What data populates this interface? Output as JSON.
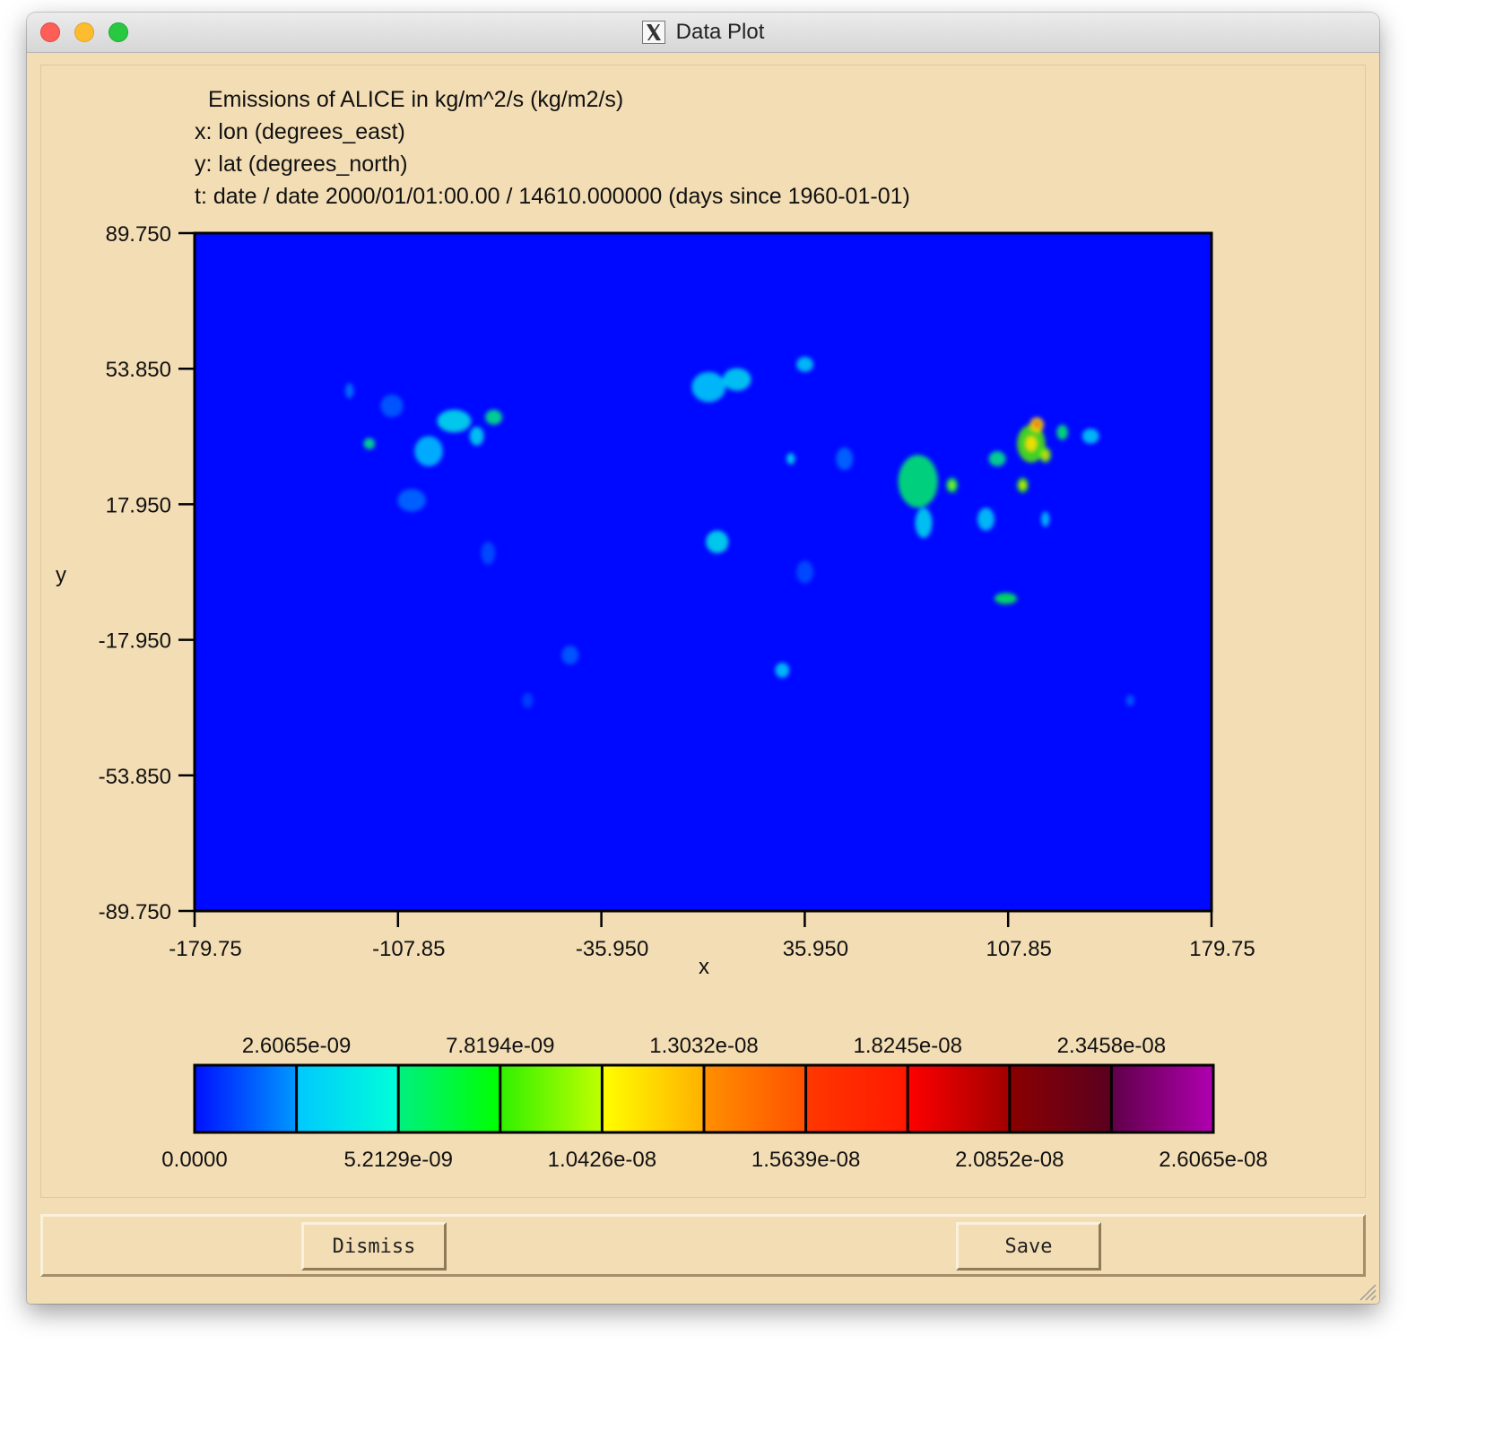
{
  "window": {
    "title": "Data Plot",
    "title_icon": "x11-icon"
  },
  "plot": {
    "header_lines": [
      "Emissions of ALICE in kg/m^2/s (kg/m2/s)",
      "x: lon  (degrees_east)",
      "y: lat  (degrees_north)",
      "t: date / date 2000/01/01:00.00 / 14610.000000 (days since 1960-01-01)"
    ],
    "xlabel": "x",
    "ylabel": "y"
  },
  "chart_data": {
    "type": "heatmap",
    "title": "Emissions of ALICE in kg/m^2/s (kg/m2/s)",
    "xlabel": "x",
    "ylabel": "y",
    "xlim": [
      -179.75,
      179.75
    ],
    "ylim": [
      -89.75,
      89.75
    ],
    "x_ticks": [
      -179.75,
      -107.85,
      -35.95,
      35.95,
      107.85,
      179.75
    ],
    "x_tick_labels": [
      "-179.75",
      "-107.85",
      "-35.950",
      "35.950",
      "107.85",
      "179.75"
    ],
    "y_ticks": [
      89.75,
      53.85,
      17.95,
      -17.95,
      -53.85,
      -89.75
    ],
    "y_tick_labels": [
      "89.750",
      "53.850",
      "17.950",
      "-17.950",
      "-53.850",
      "-89.750"
    ],
    "background_color": "#0009ff",
    "hotspots": [
      {
        "lon": -125,
        "lat": 48,
        "w": 3,
        "h": 4,
        "level": 0.08
      },
      {
        "lon": -118,
        "lat": 34,
        "w": 4,
        "h": 3,
        "level": 0.2
      },
      {
        "lon": -110,
        "lat": 44,
        "w": 8,
        "h": 6,
        "level": 0.06
      },
      {
        "lon": -97,
        "lat": 32,
        "w": 10,
        "h": 8,
        "level": 0.1
      },
      {
        "lon": -88,
        "lat": 40,
        "w": 12,
        "h": 6,
        "level": 0.16
      },
      {
        "lon": -80,
        "lat": 36,
        "w": 5,
        "h": 5,
        "level": 0.14
      },
      {
        "lon": -74,
        "lat": 41,
        "w": 6,
        "h": 4,
        "level": 0.2
      },
      {
        "lon": -103,
        "lat": 19,
        "w": 10,
        "h": 6,
        "level": 0.07
      },
      {
        "lon": -76,
        "lat": 5,
        "w": 5,
        "h": 6,
        "level": 0.05
      },
      {
        "lon": -47,
        "lat": -22,
        "w": 6,
        "h": 5,
        "level": 0.06
      },
      {
        "lon": -62,
        "lat": -34,
        "w": 4,
        "h": 4,
        "level": 0.04
      },
      {
        "lon": 2,
        "lat": 49,
        "w": 12,
        "h": 8,
        "level": 0.12
      },
      {
        "lon": 12,
        "lat": 51,
        "w": 10,
        "h": 6,
        "level": 0.14
      },
      {
        "lon": 36,
        "lat": 55,
        "w": 6,
        "h": 4,
        "level": 0.12
      },
      {
        "lon": 31,
        "lat": 30,
        "w": 3,
        "h": 3,
        "level": 0.14
      },
      {
        "lon": 5,
        "lat": 8,
        "w": 8,
        "h": 6,
        "level": 0.16
      },
      {
        "lon": 28,
        "lat": -26,
        "w": 5,
        "h": 4,
        "level": 0.12
      },
      {
        "lon": 36,
        "lat": 0,
        "w": 6,
        "h": 6,
        "level": 0.05
      },
      {
        "lon": 50,
        "lat": 30,
        "w": 6,
        "h": 6,
        "level": 0.07
      },
      {
        "lon": 76,
        "lat": 24,
        "w": 14,
        "h": 14,
        "level": 0.22
      },
      {
        "lon": 88,
        "lat": 23,
        "w": 4,
        "h": 4,
        "level": 0.26
      },
      {
        "lon": 78,
        "lat": 13,
        "w": 6,
        "h": 8,
        "level": 0.14
      },
      {
        "lon": 116,
        "lat": 34,
        "w": 10,
        "h": 10,
        "level": 0.32
      },
      {
        "lon": 118,
        "lat": 39,
        "w": 5,
        "h": 4,
        "level": 0.46
      },
      {
        "lon": 121,
        "lat": 31,
        "w": 4,
        "h": 4,
        "level": 0.34
      },
      {
        "lon": 113,
        "lat": 23,
        "w": 4,
        "h": 4,
        "level": 0.3
      },
      {
        "lon": 104,
        "lat": 30,
        "w": 6,
        "h": 4,
        "level": 0.2
      },
      {
        "lon": 127,
        "lat": 37,
        "w": 4,
        "h": 4,
        "level": 0.22
      },
      {
        "lon": 137,
        "lat": 36,
        "w": 6,
        "h": 4,
        "level": 0.12
      },
      {
        "lon": 100,
        "lat": 14,
        "w": 6,
        "h": 6,
        "level": 0.12
      },
      {
        "lon": 107,
        "lat": -7,
        "w": 8,
        "h": 3,
        "level": 0.24
      },
      {
        "lon": 121,
        "lat": 14,
        "w": 3,
        "h": 4,
        "level": 0.1
      },
      {
        "lon": 151,
        "lat": -34,
        "w": 3,
        "h": 3,
        "level": 0.06
      }
    ]
  },
  "colorbar": {
    "top_labels": [
      "2.6065e-09",
      "7.8194e-09",
      "1.3032e-08",
      "1.8245e-08",
      "2.3458e-08"
    ],
    "bottom_labels": [
      "0.0000",
      "5.2129e-09",
      "1.0426e-08",
      "1.5639e-08",
      "2.0852e-08",
      "2.6065e-08"
    ],
    "min": 0,
    "max": 2.6065e-08,
    "segment_colors": [
      [
        "#0010ff",
        "#0098ff"
      ],
      [
        "#00c8ff",
        "#00ffd8"
      ],
      [
        "#00f080",
        "#00ff00"
      ],
      [
        "#30f000",
        "#c0ff00"
      ],
      [
        "#ffff00",
        "#ffb000"
      ],
      [
        "#ff9000",
        "#ff5000"
      ],
      [
        "#ff3800",
        "#ff1800"
      ],
      [
        "#ff0000",
        "#a00000"
      ],
      [
        "#8a0000",
        "#5a0020"
      ],
      [
        "#600048",
        "#b000b0"
      ]
    ]
  },
  "buttons": {
    "dismiss_label": "Dismiss",
    "save_label": "Save"
  }
}
